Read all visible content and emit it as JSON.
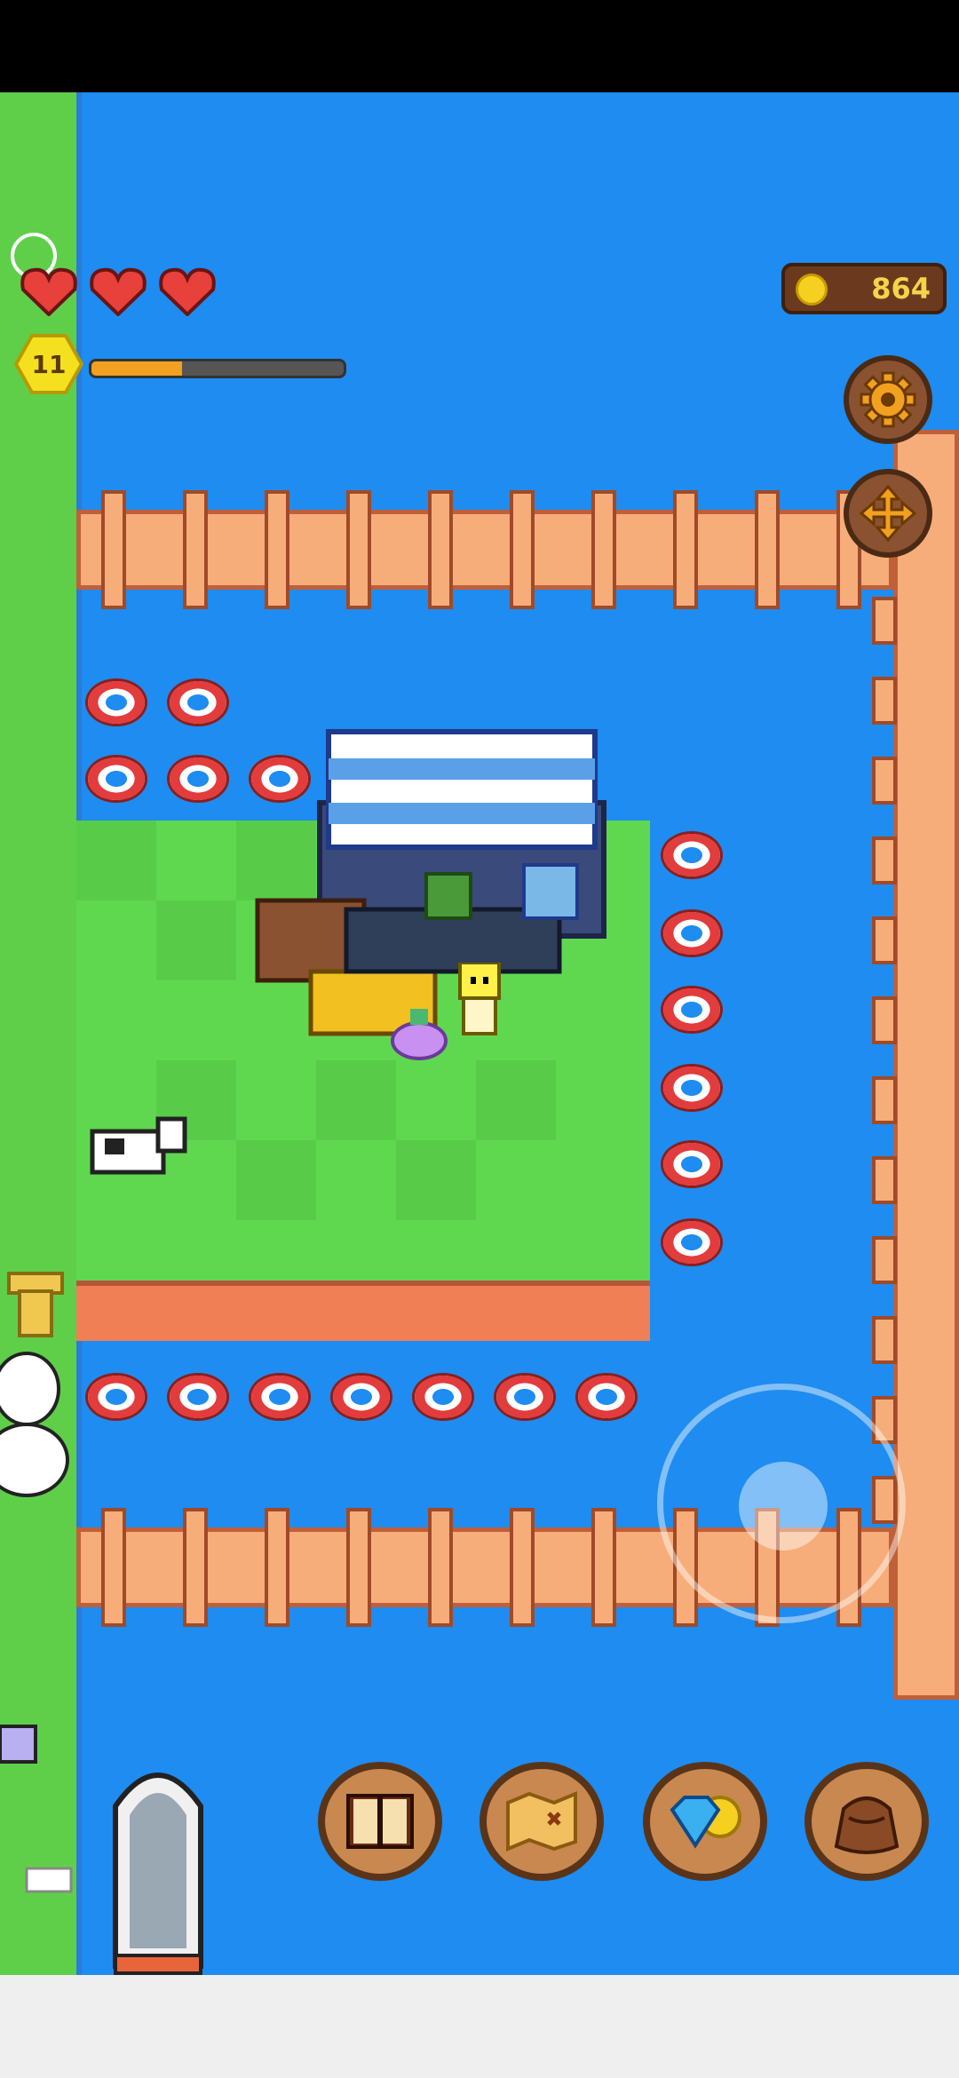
{
  "hud": {
    "hearts": 3,
    "level": "11",
    "xp_progress": 0.36,
    "coins": "864",
    "settings_icon": "gear-icon",
    "move_icon": "move-arrows-icon"
  },
  "menu": {
    "buttons": [
      {
        "name": "journal-button",
        "icon": "book-icon"
      },
      {
        "name": "treasure-map-button",
        "icon": "map-icon"
      },
      {
        "name": "shop-button",
        "icon": "gem-coin-icon"
      },
      {
        "name": "inventory-button",
        "icon": "bag-icon"
      }
    ]
  },
  "colors": {
    "water": "#1e8cf0",
    "grass": "#5fd850",
    "dock": "#f6ad7a",
    "xp_fill": "#f2a020",
    "coin_text": "#f5d44a"
  }
}
